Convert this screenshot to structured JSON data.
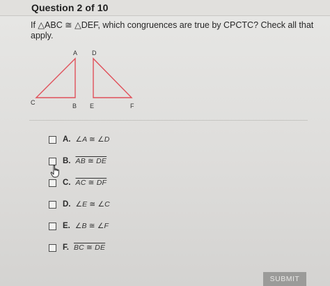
{
  "header": {
    "question_number": "Question 2 of 10"
  },
  "question": {
    "prompt_line1": "If △ABC ≅ △DEF, which congruences are true by CPCTC? Check all that",
    "prompt_line2": "apply."
  },
  "figure": {
    "triangle1_vertices": [
      "A",
      "C",
      "B"
    ],
    "triangle2_vertices": [
      "D",
      "E",
      "F"
    ],
    "edge_color": "#e0505a"
  },
  "options": [
    {
      "letter": "A.",
      "text": "∠A ≅ ∠D"
    },
    {
      "letter": "B.",
      "text": "AB ≅ DE"
    },
    {
      "letter": "C.",
      "text": "AC ≅ DF"
    },
    {
      "letter": "D.",
      "text": "∠E ≅ ∠C"
    },
    {
      "letter": "E.",
      "text": "∠B ≅ ∠F"
    },
    {
      "letter": "F.",
      "text": "BC ≅ DE"
    }
  ],
  "submit": {
    "label": "SUBMIT"
  }
}
